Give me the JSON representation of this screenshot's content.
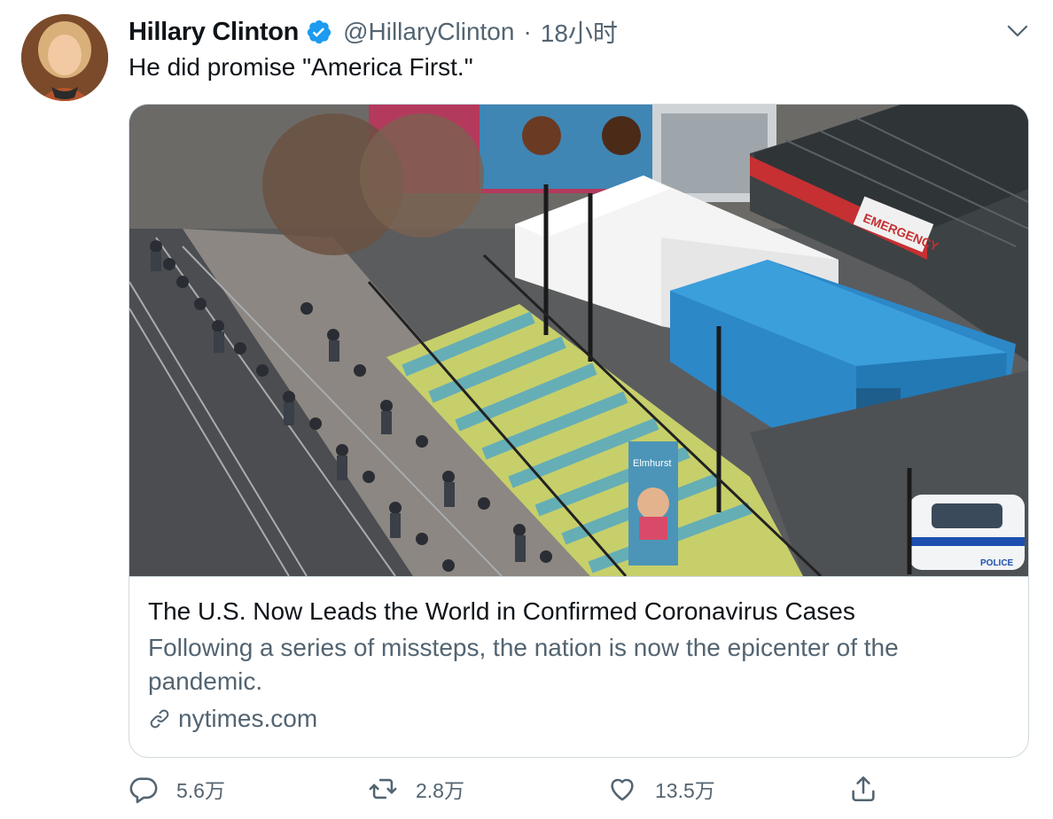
{
  "tweet": {
    "author_name": "Hillary Clinton",
    "handle": "@HillaryClinton",
    "separator": "·",
    "time": "18小时",
    "text": "He did promise \"America First.\""
  },
  "card": {
    "title": "The U.S. Now Leads the World in Confirmed Coronavirus Cases",
    "description": "Following a series of missteps, the nation is now the epicenter of the pandemic.",
    "domain": "nytimes.com",
    "image_signs": {
      "emergency": "EMERGENCY",
      "banner": "Elmhurst",
      "police": "POLICE"
    }
  },
  "actions": {
    "reply_count": "5.6万",
    "retweet_count": "2.8万",
    "like_count": "13.5万"
  },
  "colors": {
    "text_primary": "#0f1419",
    "text_secondary": "#536471",
    "verified_blue": "#1d9bf0",
    "border": "#cfd9de"
  },
  "icons": [
    "verified-badge-icon",
    "chevron-down-icon",
    "link-icon",
    "reply-icon",
    "retweet-icon",
    "like-icon",
    "share-icon"
  ]
}
